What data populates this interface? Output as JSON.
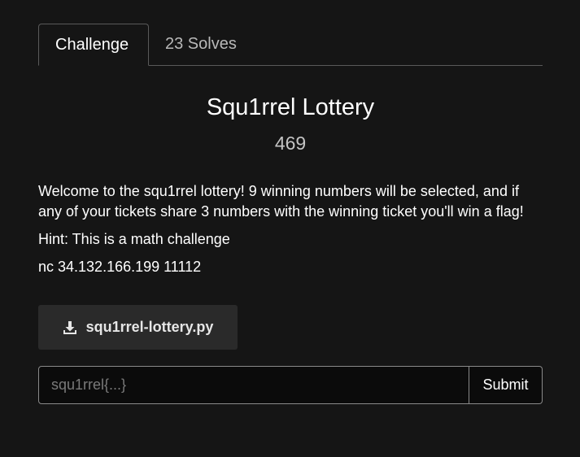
{
  "tabs": [
    {
      "label": "Challenge",
      "active": true
    },
    {
      "label": "23 Solves",
      "active": false
    }
  ],
  "challenge": {
    "name": "Squ1rrel Lottery",
    "points": "469",
    "description": [
      "Welcome to the squ1rrel lottery! 9 winning numbers will be selected, and if any of your tickets share 3 numbers with the winning ticket you'll win a flag!",
      "Hint: This is a math challenge",
      "nc 34.132.166.199 11112"
    ],
    "file": {
      "name": "squ1rrel-lottery.py",
      "icon": "download-icon"
    }
  },
  "submission": {
    "placeholder": "squ1rrel{...}",
    "value": "",
    "submit_label": "Submit"
  },
  "colors": {
    "background": "#151515",
    "file_button": "#2a2a2a",
    "input_background": "#0b0b0b",
    "border": "#8a8a8a"
  }
}
